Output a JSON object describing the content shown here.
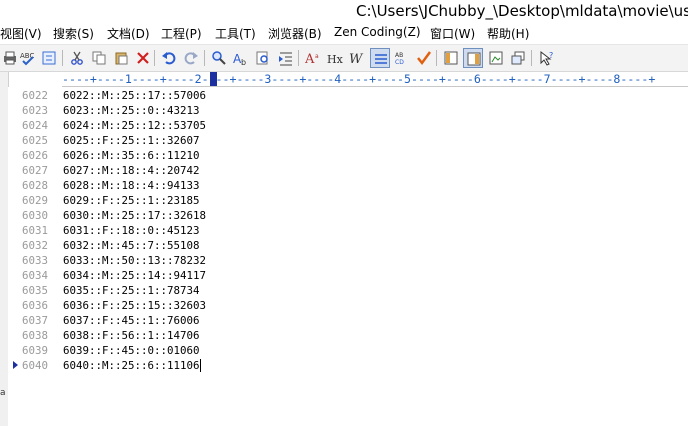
{
  "window": {
    "title": "C:\\Users\\JChubby_\\Desktop\\mldata\\movie\\us"
  },
  "menu": [
    {
      "label": "视图(V)",
      "key": "view"
    },
    {
      "label": "搜索(S)",
      "key": "search"
    },
    {
      "label": "文档(D)",
      "key": "document"
    },
    {
      "label": "工程(P)",
      "key": "project"
    },
    {
      "label": "工具(T)",
      "key": "tools"
    },
    {
      "label": "浏览器(B)",
      "key": "browser"
    },
    {
      "label": "Zen Coding(Z)",
      "key": "zen-coding"
    },
    {
      "label": "窗口(W)",
      "key": "window"
    },
    {
      "label": "帮助(H)",
      "key": "help"
    }
  ],
  "toolbar": {
    "buttons": [
      {
        "icon": "print-icon"
      },
      {
        "icon": "spellcheck-icon"
      },
      {
        "icon": "word-wrap-toggle-icon"
      },
      {
        "icon": "cut-icon"
      },
      {
        "icon": "copy-icon"
      },
      {
        "icon": "paste-icon"
      },
      {
        "icon": "delete-icon"
      },
      {
        "icon": "undo-icon"
      },
      {
        "icon": "redo-icon"
      },
      {
        "icon": "find-icon"
      },
      {
        "icon": "replace-icon"
      },
      {
        "icon": "find-in-files-icon"
      },
      {
        "icon": "indent-icon"
      },
      {
        "icon": "font-icon"
      },
      {
        "icon": "html-tag-icon"
      },
      {
        "icon": "italic-w-icon"
      },
      {
        "icon": "wrap-lines-icon",
        "active": true
      },
      {
        "icon": "abc-case-icon"
      },
      {
        "icon": "checkmark-icon"
      },
      {
        "icon": "panel-left-icon"
      },
      {
        "icon": "panel-active-icon",
        "active": true
      },
      {
        "icon": "panel-image-icon"
      },
      {
        "icon": "window-restore-icon"
      },
      {
        "icon": "help-cursor-icon"
      }
    ]
  },
  "ruler": {
    "text": "----+----1----+----2----+----3----+----4----+----5----+----6----+----7----+----8----+"
  },
  "editor": {
    "current_line": "6040",
    "lines": [
      {
        "num": "6022",
        "text": "6022::M::25::17::57006"
      },
      {
        "num": "6023",
        "text": "6023::M::25::0::43213"
      },
      {
        "num": "6024",
        "text": "6024::M::25::12::53705"
      },
      {
        "num": "6025",
        "text": "6025::F::25::1::32607"
      },
      {
        "num": "6026",
        "text": "6026::M::35::6::11210"
      },
      {
        "num": "6027",
        "text": "6027::M::18::4::20742"
      },
      {
        "num": "6028",
        "text": "6028::M::18::4::94133"
      },
      {
        "num": "6029",
        "text": "6029::F::25::1::23185"
      },
      {
        "num": "6030",
        "text": "6030::M::25::17::32618"
      },
      {
        "num": "6031",
        "text": "6031::F::18::0::45123"
      },
      {
        "num": "6032",
        "text": "6032::M::45::7::55108"
      },
      {
        "num": "6033",
        "text": "6033::M::50::13::78232"
      },
      {
        "num": "6034",
        "text": "6034::M::25::14::94117"
      },
      {
        "num": "6035",
        "text": "6035::F::25::1::78734"
      },
      {
        "num": "6036",
        "text": "6036::F::25::15::32603"
      },
      {
        "num": "6037",
        "text": "6037::F::45::1::76006"
      },
      {
        "num": "6038",
        "text": "6038::F::56::1::14706"
      },
      {
        "num": "6039",
        "text": "6039::F::45::0::01060"
      },
      {
        "num": "6040",
        "text": "6040::M::25::6::11106"
      }
    ]
  },
  "side_strip": {
    "letter": "a"
  }
}
